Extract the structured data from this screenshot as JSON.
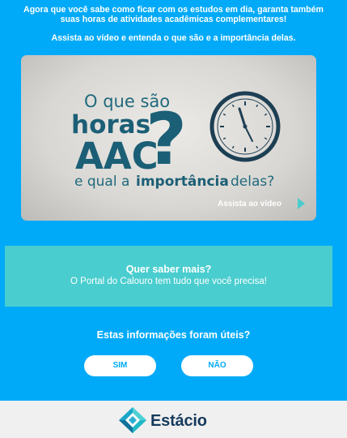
{
  "intro": {
    "line1": "Agora que você sabe como ficar com os estudos em dia, garanta também",
    "line2": "suas horas de atividades acadêmicas complementares!",
    "line3": "Assista ao vídeo e entenda o que são e a importância delas."
  },
  "video": {
    "text1": "O que são",
    "text2": "horas",
    "text3": "AAC",
    "text4a": "e qual a",
    "text4b": "importância",
    "text4c": "delas?",
    "question_mark": "?",
    "cta": "Assista ao vídeo",
    "icons": [
      "clock-icon",
      "play-icon"
    ]
  },
  "banner": {
    "title": "Quer saber mais?",
    "subtitle": "O Portal do Calouro tem tudo que você precisa!"
  },
  "feedback": {
    "question": "Estas informações foram úteis?",
    "yes_label": "SIM",
    "no_label": "NÃO"
  },
  "footer": {
    "brand": "Estácio",
    "icon": "estacio-logo-icon"
  },
  "colors": {
    "background": "#00aaf8",
    "banner": "#4acdcf",
    "video_text": "#1b5f76",
    "footer": "#f0f0f0",
    "brand": "#163a5c"
  }
}
